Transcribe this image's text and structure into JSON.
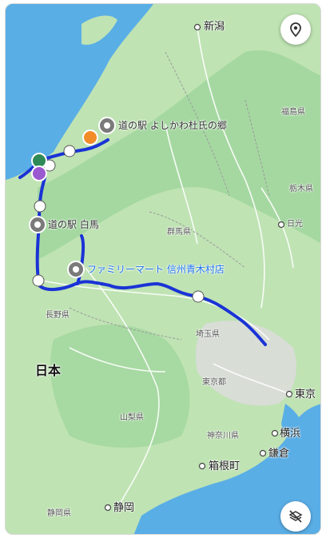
{
  "map": {
    "colors": {
      "sea": "#5aaee6",
      "land": "#bfe3b3",
      "mountain": "#8fcf92",
      "urban": "#dcdcdc",
      "route": "#1a33d6",
      "road": "#ffffff"
    },
    "labels": {
      "niigata": "新潟",
      "fukushima": "福島県",
      "tochigi": "栃木県",
      "nikko": "日光",
      "gunma": "群馬県",
      "nagano": "長野県",
      "saitama": "埼玉県",
      "tokyo_pref": "東京都",
      "tokyo": "東京",
      "yamanashi": "山梨県",
      "kanagawa": "神奈川県",
      "yokohama": "横浜",
      "kamakura": "鎌倉",
      "hakone": "箱根町",
      "shizuoka_pref": "静岡県",
      "shizuoka": "静岡",
      "japan": "日本"
    },
    "pois": {
      "michinoeki_yoshikawa": "道の駅 よしかわ杜氏の郷",
      "michinoeki_hakuba": "道の駅 白馬",
      "familymart": "ファミリーマート 信州青木村店"
    },
    "icons": {
      "location": "location-pin-icon",
      "layers": "layers-off-icon"
    }
  }
}
